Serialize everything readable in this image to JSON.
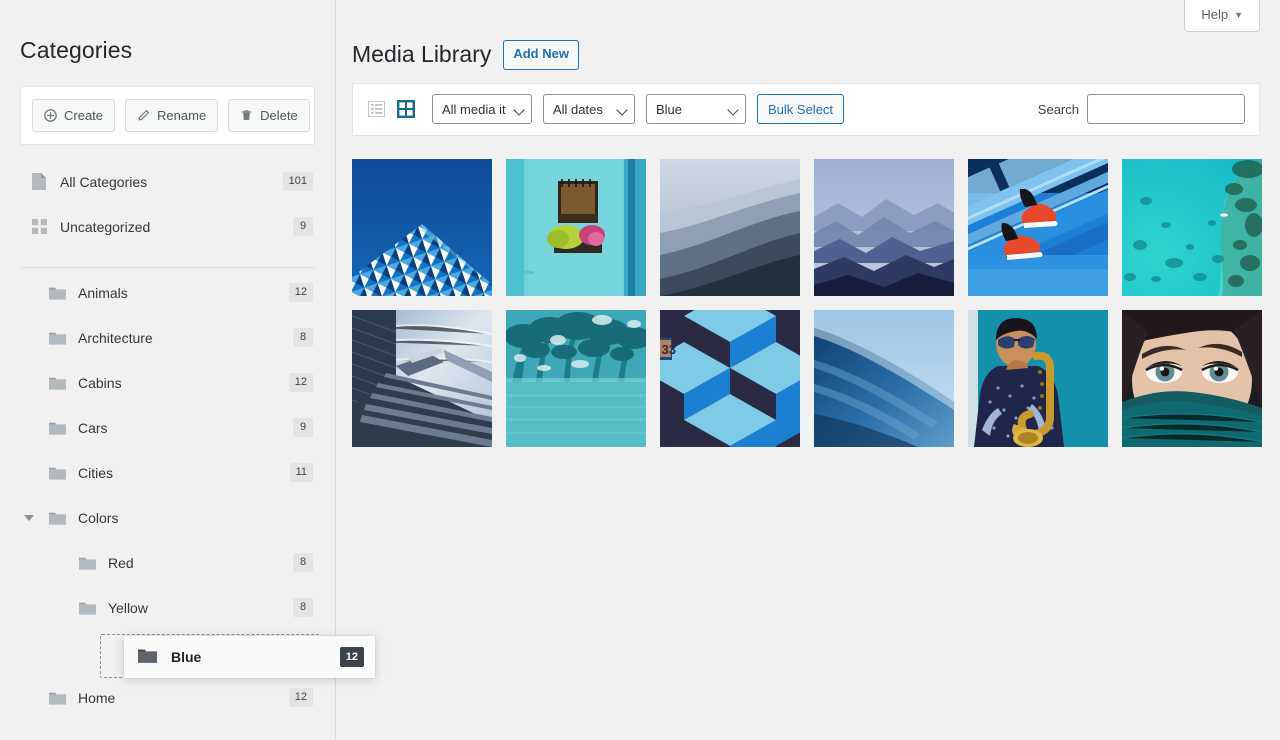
{
  "help": {
    "label": "Help",
    "caret": "▼",
    "icon": "chevron-down-icon"
  },
  "sidebar": {
    "title": "Categories",
    "actions": [
      {
        "label": "Create",
        "icon": "plus-circle-icon"
      },
      {
        "label": "Rename",
        "icon": "pencil-icon"
      },
      {
        "label": "Delete",
        "icon": "trash-icon"
      }
    ],
    "top_items": [
      {
        "label": "All Categories",
        "count": "101",
        "icon": "page-icon",
        "depth": 0
      },
      {
        "label": "Uncategorized",
        "count": "9",
        "icon": "grid-squares-icon",
        "depth": 0
      }
    ],
    "tree": [
      {
        "label": "Animals",
        "count": "12",
        "icon": "folder-icon",
        "depth": 1,
        "expandable": false
      },
      {
        "label": "Architecture",
        "count": "8",
        "icon": "folder-icon",
        "depth": 1,
        "expandable": false
      },
      {
        "label": "Cabins",
        "count": "12",
        "icon": "folder-icon",
        "depth": 1,
        "expandable": false
      },
      {
        "label": "Cars",
        "count": "9",
        "icon": "folder-icon",
        "depth": 1,
        "expandable": false
      },
      {
        "label": "Cities",
        "count": "11",
        "icon": "folder-icon",
        "depth": 1,
        "expandable": false
      },
      {
        "label": "Colors",
        "count": "",
        "icon": "folder-icon",
        "depth": 1,
        "expandable": true
      },
      {
        "label": "Red",
        "count": "8",
        "icon": "folder-icon",
        "depth": 2,
        "expandable": false
      },
      {
        "label": "Yellow",
        "count": "8",
        "icon": "folder-icon",
        "depth": 2,
        "expandable": false
      }
    ],
    "after_drag": [
      {
        "label": "Home",
        "count": "12",
        "icon": "folder-icon",
        "depth": 1,
        "expandable": false
      }
    ],
    "drag": {
      "label": "Blue",
      "count": "12",
      "icon": "folder-icon"
    }
  },
  "main": {
    "title": "Media Library",
    "add_new_label": "Add New",
    "toolbar": {
      "list_view_icon": "list-view-icon",
      "grid_view_icon": "grid-view-icon",
      "media_type": "All media it",
      "date_filter": "All dates",
      "category_filter": "Blue",
      "bulk_select_label": "Bulk Select",
      "search_label": "Search",
      "search_value": "",
      "search_placeholder": ""
    },
    "items": [
      {
        "alt": "blue-triangular-facade-building"
      },
      {
        "alt": "turquoise-wall-window-flowerbox"
      },
      {
        "alt": "misty-blue-mountain-ridges"
      },
      {
        "alt": "layered-blue-mountain-haze"
      },
      {
        "alt": "red-sneakers-on-blue-stairs"
      },
      {
        "alt": "aerial-turquoise-lagoon-reef"
      },
      {
        "alt": "concrete-staircase-under-sky"
      },
      {
        "alt": "palm-trees-reflected-in-pool"
      },
      {
        "alt": "blue-cube-geometric-pattern"
      },
      {
        "alt": "deep-blue-ocean-wave"
      },
      {
        "alt": "saxophone-player-on-teal-wall"
      },
      {
        "alt": "womans-eyes-above-teal-scarf"
      }
    ]
  },
  "colors": {
    "accent": "#2271b1",
    "grid_active": "#1a6a8e",
    "badge_bg": "#e4e4e4",
    "badge_dark_bg": "#3c434a",
    "page_bg": "#f1f1f1"
  }
}
